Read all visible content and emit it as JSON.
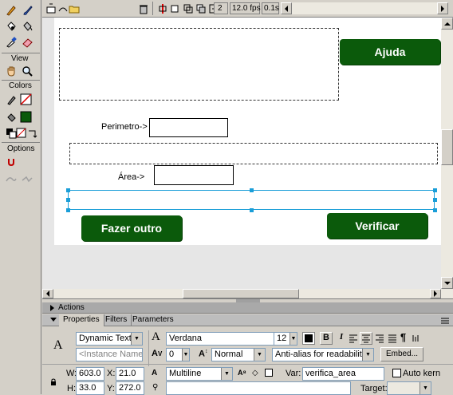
{
  "toolbox": {
    "section_view": "View",
    "section_colors": "Colors",
    "section_options": "Options"
  },
  "timeline": {
    "frame": "2",
    "fps": "12.0 fps",
    "time": "0.1s"
  },
  "stage": {
    "ajuda_label": "Ajuda",
    "perimetro_label": "Perimetro->",
    "area_label": "Área->",
    "fazer_outro_label": "Fazer outro",
    "verificar_label": "Verificar"
  },
  "panels": {
    "actions_title": "Actions",
    "tabs": [
      "Properties",
      "Filters",
      "Parameters"
    ]
  },
  "properties": {
    "text_type": "Dynamic Text",
    "instance_placeholder": "<Instance Name>",
    "font": "Verdana",
    "font_size": "12",
    "spacing": "0",
    "position_mode": "Normal",
    "anti_alias": "Anti-alias for readability",
    "embed_label": "Embed...",
    "w_label": "W:",
    "w_value": "603.0",
    "x_label": "X:",
    "x_value": "21.0",
    "h_label": "H:",
    "h_value": "33.0",
    "y_label": "Y:",
    "y_value": "272.0",
    "line_type": "Multiline",
    "var_label": "Var:",
    "var_value": "verifica_area",
    "auto_kern_label": "Auto kern",
    "target_label": "Target:",
    "bold": "B",
    "italic": "I"
  },
  "colors": {
    "accent_green": "#0b5a0b",
    "selection_blue": "#1a9ed8"
  }
}
